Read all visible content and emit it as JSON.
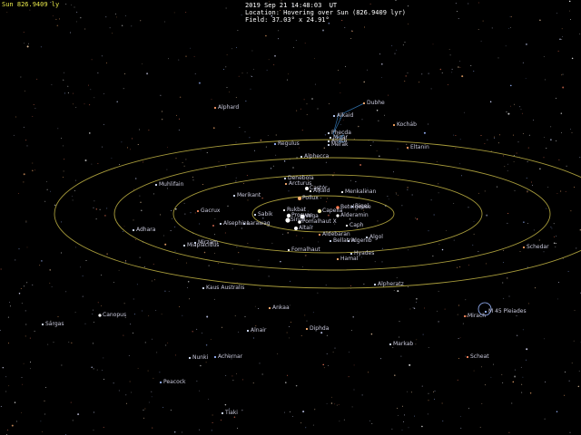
{
  "colors": {
    "background": "#000000",
    "hud_yellow": "#e8e84a",
    "hud_white": "#ffffff",
    "label": "#c9c9dc",
    "orbit": "#a69a3a",
    "constellation_line": "#2f6fa8"
  },
  "hud": {
    "distance": "Sun 826.9409 ly",
    "datetime": "2019 Sep 21 14:48:03  UT",
    "location": "Location: Hovering over Sun (826.9409 lyr)",
    "field": "Field: 37.03° x 24.91°"
  },
  "objects": [
    {
      "id": "alphard",
      "name": "Alphard",
      "color": "#ff9a6a"
    },
    {
      "id": "alkaid",
      "name": "Alkaid",
      "color": "#bfd2ff"
    },
    {
      "id": "dubhe",
      "name": "Dubhe",
      "color": "#ffb070"
    },
    {
      "id": "kochab",
      "name": "Kochab",
      "color": "#ffa860"
    },
    {
      "id": "phecda",
      "name": "Phecda",
      "color": "#dce6ff"
    },
    {
      "id": "mizar",
      "name": "Mizar",
      "color": "#dce6ff"
    },
    {
      "id": "alioth",
      "name": "Alioth",
      "color": "#dce6ff"
    },
    {
      "id": "merak",
      "name": "Merak",
      "color": "#dce6ff"
    },
    {
      "id": "eltanin",
      "name": "Eltanin",
      "color": "#ff9a60"
    },
    {
      "id": "regulus",
      "name": "Regulus",
      "color": "#9ab6ff"
    },
    {
      "id": "alphecca",
      "name": "Alphecca",
      "color": "#dce6ff"
    },
    {
      "id": "denebola",
      "name": "Denebola",
      "color": "#dce6ff"
    },
    {
      "id": "arcturus",
      "name": "Arcturus",
      "color": "#ffb070"
    },
    {
      "id": "castor",
      "name": "Castor",
      "color": "#ffffff"
    },
    {
      "id": "alkaid2",
      "name": "Alkaid",
      "color": "#ffffff"
    },
    {
      "id": "menkalinan",
      "name": "Menkalinan",
      "color": "#ffffff"
    },
    {
      "id": "muhlifain",
      "name": "Muhlifain",
      "color": "#dce6ff"
    },
    {
      "id": "merikant",
      "name": "Merikant",
      "color": "#dce6ff"
    },
    {
      "id": "pollux",
      "name": "Pollux",
      "color": "#ffb070"
    },
    {
      "id": "betelgeuse",
      "name": "Betelgeuse",
      "color": "#ff7040"
    },
    {
      "id": "bellatrix_r",
      "name": "Rigel",
      "color": "#cfe0ff"
    },
    {
      "id": "gacrux",
      "name": "Gacrux",
      "color": "#ff8a60"
    },
    {
      "id": "sabik",
      "name": "Sabik",
      "color": "#dce6ff"
    },
    {
      "id": "procyon_group",
      "name": "Rukbat",
      "color": "#ffffff"
    },
    {
      "id": "capella",
      "name": "Capella",
      "color": "#fff2b0"
    },
    {
      "id": "alderamin",
      "name": "Alderamin",
      "color": "#ffffff"
    },
    {
      "id": "procyon",
      "name": "Procyon",
      "color": "#ffffff"
    },
    {
      "id": "vega",
      "name": "Vega",
      "color": "#ffffff"
    },
    {
      "id": "sirius",
      "name": "Sirius",
      "color": "#ffffff"
    },
    {
      "id": "fomalhaut_x",
      "name": "Fomalhaut X",
      "color": "#ffffff"
    },
    {
      "id": "alsephina",
      "name": "Alsephina",
      "color": "#dce6ff"
    },
    {
      "id": "larawag",
      "name": "Larawag",
      "color": "#dce6ff"
    },
    {
      "id": "caph",
      "name": "Caph",
      "color": "#ffffff"
    },
    {
      "id": "altair",
      "name": "Altair",
      "color": "#ffffff"
    },
    {
      "id": "adhara",
      "name": "Adhara",
      "color": "#dce6ff"
    },
    {
      "id": "miaplacidus",
      "name": "Miaplacidus",
      "color": "#dce6ff"
    },
    {
      "id": "mirzam",
      "name": "Mirzam",
      "color": "#dce6ff"
    },
    {
      "id": "aldebaran",
      "name": "Aldebaran",
      "color": "#ff9a60"
    },
    {
      "id": "bellatrix",
      "name": "Bellatrix",
      "color": "#dce6ff"
    },
    {
      "id": "algenib",
      "name": "Algenib",
      "color": "#dce6ff"
    },
    {
      "id": "algol",
      "name": "Algol",
      "color": "#dce6ff"
    },
    {
      "id": "fomalhaut",
      "name": "Fomalhaut",
      "color": "#ffffff"
    },
    {
      "id": "hyades",
      "name": "Hyades",
      "color": "#dce6ff"
    },
    {
      "id": "hamal",
      "name": "Hamal",
      "color": "#ffb070"
    },
    {
      "id": "schedar",
      "name": "Schedar",
      "color": "#ffa060"
    },
    {
      "id": "kaus_australis",
      "name": "Kaus Australis",
      "color": "#dce6ff"
    },
    {
      "id": "alpheratz",
      "name": "Alpheratz",
      "color": "#dce6ff"
    },
    {
      "id": "ankaa",
      "name": "Ankaa",
      "color": "#ffb070"
    },
    {
      "id": "mirach",
      "name": "Mirach",
      "color": "#ff8a60"
    },
    {
      "id": "m45",
      "name": "M 45 Pleiades",
      "color": "#9ab6ff"
    },
    {
      "id": "canopus",
      "name": "Canopus",
      "color": "#ffffff"
    },
    {
      "id": "sargas",
      "name": "Sargas",
      "color": "#dce6ff"
    },
    {
      "id": "alnair",
      "name": "Alnair",
      "color": "#dce6ff"
    },
    {
      "id": "diphda",
      "name": "Diphda",
      "color": "#ffb070"
    },
    {
      "id": "markab",
      "name": "Markab",
      "color": "#dce6ff"
    },
    {
      "id": "nunki",
      "name": "Nunki",
      "color": "#dce6ff"
    },
    {
      "id": "achernar",
      "name": "Achernar",
      "color": "#9ab6ff"
    },
    {
      "id": "scheat",
      "name": "Scheat",
      "color": "#ff8a60"
    },
    {
      "id": "peacock",
      "name": "Peacock",
      "color": "#9ab6ff"
    },
    {
      "id": "tiaki",
      "name": "Tiaki",
      "color": "#dce6ff"
    }
  ]
}
